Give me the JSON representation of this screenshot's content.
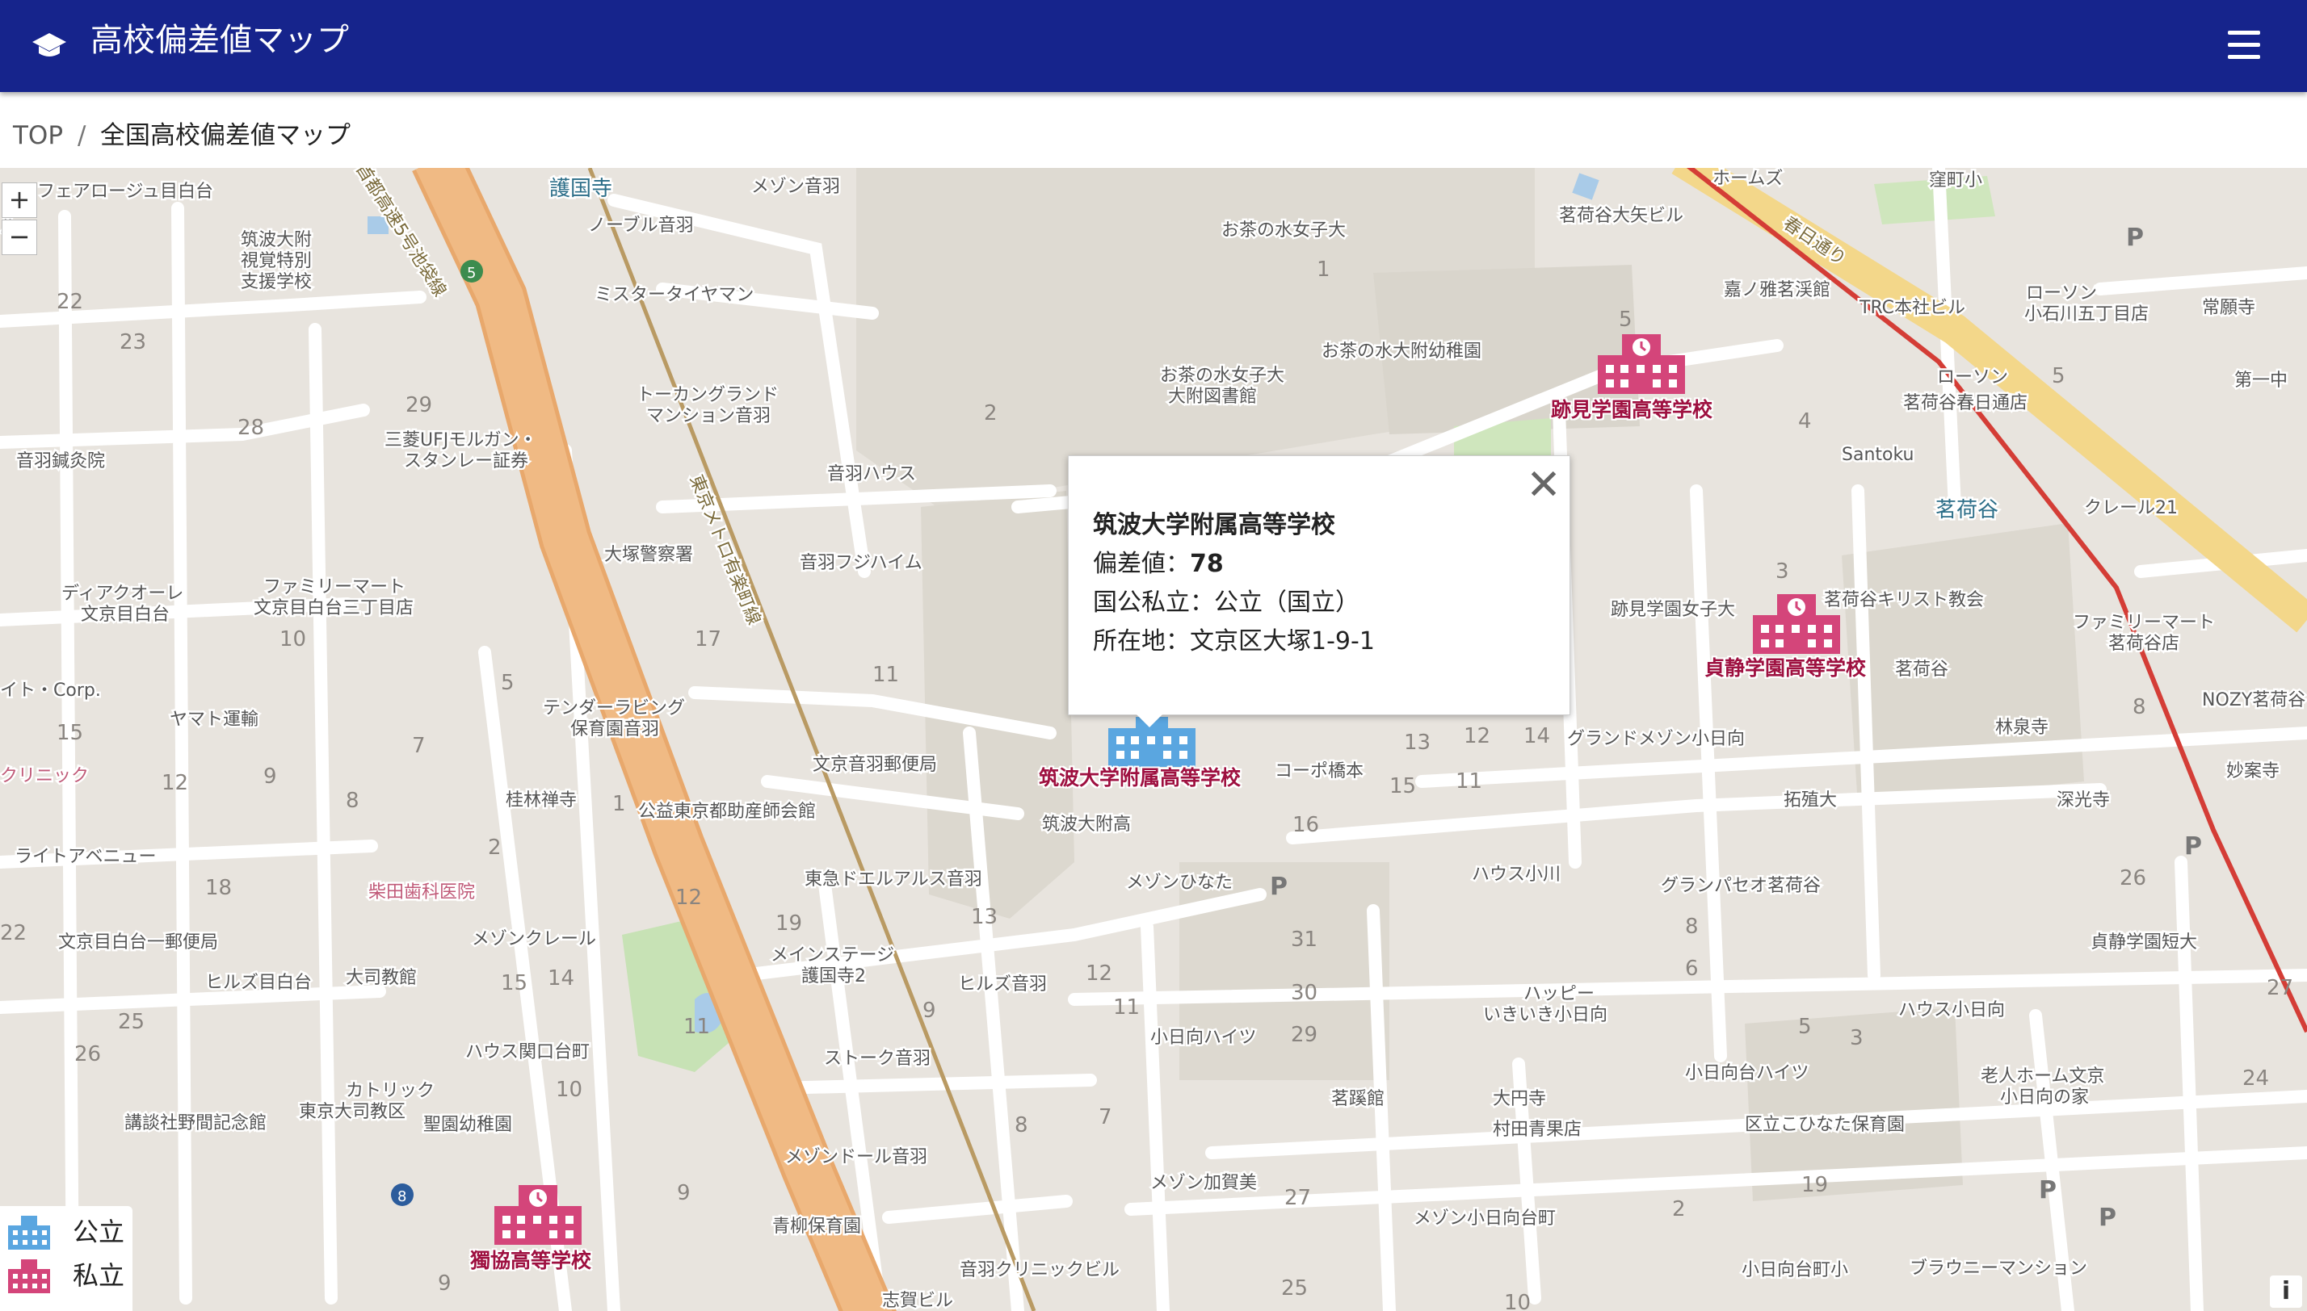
{
  "header": {
    "title": "高校偏差値マップ",
    "bg_color": "#16248c",
    "logo_icon": "graduation-cap-icon",
    "menu_icon": "hamburger-menu-icon"
  },
  "breadcrumb": {
    "home": "TOP",
    "separator": "/",
    "current": "全国高校偏差値マップ"
  },
  "map": {
    "zoom_in": "+",
    "zoom_out": "−",
    "info": "i",
    "popup": {
      "close": "✕",
      "name": "筑波大学附属高等学校",
      "deviation_label": "偏差値：",
      "deviation_value": "78",
      "type_line": "国公私立：公立（国立）",
      "address_line": "所在地：文京区大塚1-9-1"
    },
    "markers": [
      {
        "name": "筑波大学附属高等学校",
        "type": "public",
        "color": "#5aa6e0"
      },
      {
        "name": "跡見学園高等学校",
        "type": "private",
        "color": "#d4457a"
      },
      {
        "name": "貞静学園高等学校",
        "type": "private",
        "color": "#d4457a"
      },
      {
        "name": "獨協高等学校",
        "type": "private",
        "color": "#d4457a"
      }
    ],
    "legend": [
      {
        "label": "公立",
        "color": "#5aa6e0",
        "icon": "school-building-icon"
      },
      {
        "label": "私立",
        "color": "#d4457a",
        "icon": "school-building-icon"
      }
    ],
    "place_labels": {
      "gokokuji": "護国寺",
      "maison_otowa": "メゾン音羽",
      "ferrage": "フェアロージュ目白台",
      "tsukuba_special_1": "筑波大附",
      "tsukuba_special_2": "視覚特別",
      "tsukuba_special_3": "支援学校",
      "noble": "ノーブル音羽",
      "mister_tire": "ミスタータイヤマン",
      "ochanomizu": "お茶の水女子大",
      "ochanomizu_lib_1": "お茶の水女子大",
      "ochanomizu_lib_2": "大附図書館",
      "ochanomizu_kinder": "お茶の水大附幼稚園",
      "tokangrand_1": "トーカングランド",
      "tokangrand_2": "マンション音羽",
      "mufg_1": "三菱UFJモルガン・",
      "mufg_2": "スタンレー証券",
      "otowa_house": "音羽ハウス",
      "otowa_acupuncture": "音羽鍼灸院",
      "otsuka_police": "大塚警察署",
      "familymart_1": "ファミリーマート",
      "familymart_2": "文京目白台三丁目店",
      "otowa_fujihaim": "音羽フジハイム",
      "dear_court_1": "ディアクオーレ",
      "dear_court_2": "文京目白台",
      "subway": "東京メトロ有楽町線",
      "yamato": "ヤマト運輸",
      "tender_1": "テンダーラビング",
      "tender_2": "保育園音羽",
      "otowa_post": "文京音羽郵便局",
      "keirinzenji": "桂林禅寺",
      "tokyo_doctors": "公益東京都助産師会館",
      "light_avenue": "ライトアベニュー",
      "tsukuba_fuzoku": "筑波大附高",
      "kopo": "コーポ橋本",
      "maison_hinata": "メゾンひなた",
      "tokyu_dorel": "東急ドエルアルス音羽",
      "shibata": "柴田歯科医院",
      "mejirodai_post": "文京目白台一郵便局",
      "maison_clair": "メゾンクレール",
      "hills_mejirodai": "ヒルズ目白台",
      "taishi": "大司教館",
      "mainstage_1": "メインステージ",
      "mainstage_2": "護国寺2",
      "hills_otowa": "ヒルズ音羽",
      "house_sekiguchi": "ハウス関口台町",
      "stork": "ストーク音羽",
      "catholic_1": "カトリック",
      "catholic_2": "東京大司教区",
      "seisei": "聖園幼稚園",
      "kodansha": "講談社野間記念館",
      "maison_dore": "メゾンドール音羽",
      "aoba": "青柳保育園",
      "otowa_clinic": "音羽クリニックビル",
      "shiga": "志賀ビル",
      "kohinata_heights": "小日向ハイツ",
      "meikeikan": "茗蹊館",
      "oenji": "大円寺",
      "muratai": "村田青果店",
      "maison_kaga": "メゾン加賀美",
      "maison_kohinata": "メゾン小日向台町",
      "happy_1": "ハッピー",
      "happy_2": "いきいき小日向",
      "house_ogawa": "ハウス小川",
      "granpaseo": "グランパセオ茗荷谷",
      "grand_maison": "グランドメゾン小日向",
      "takushoku": "拓殖大",
      "atomi_joshi": "跡見学園女子大",
      "rinsenji": "林泉寺",
      "fukkoji": "深光寺",
      "myogadani_church": "茗荷谷キリスト教会",
      "myogadani": "茗荷谷",
      "myogadani_str": "茗荷谷",
      "tetsugaku": "クレール21",
      "familymart_m_1": "ファミリーマート",
      "familymart_m_2": "茗荷谷店",
      "nozy": "NOZY茗荷谷",
      "myoenji": "妙案寺",
      "teisei_tanki": "貞静学園短大",
      "house_kohinata": "ハウス小日向",
      "rojin_1": "老人ホーム文京",
      "rojin_2": "小日向の家",
      "kohinata_hoiku": "区立こひなた保育園",
      "kohinata_hights2": "小日向台ハイツ",
      "brownie": "ブラウニーマンション",
      "kohinata_elem": "小日向台町小",
      "myogadani_kasuga": "茗荷谷春日通店",
      "lawson_1": "ローソン",
      "lawson_2": "小石川五丁目店",
      "lawson_3": "ローソン",
      "trc": "TRC本社ビル",
      "santoku": "Santoku",
      "jougansi": "常願寺",
      "daiichi": "第一中",
      "kubomachi": "窪町小",
      "holmes": "ホームズ",
      "kasuga_dori": "春日通り",
      "myogadani_taishi": "茗荷谷大矢ビル",
      "kagamino": "嘉ノ雅茗渓館",
      "taka": "高",
      "corp": "イト・Corp.",
      "clinic": "クリニック",
      "route5": "5",
      "route8": "8",
      "highway": "首都高速5号池袋線",
      "rou": "ル"
    }
  }
}
